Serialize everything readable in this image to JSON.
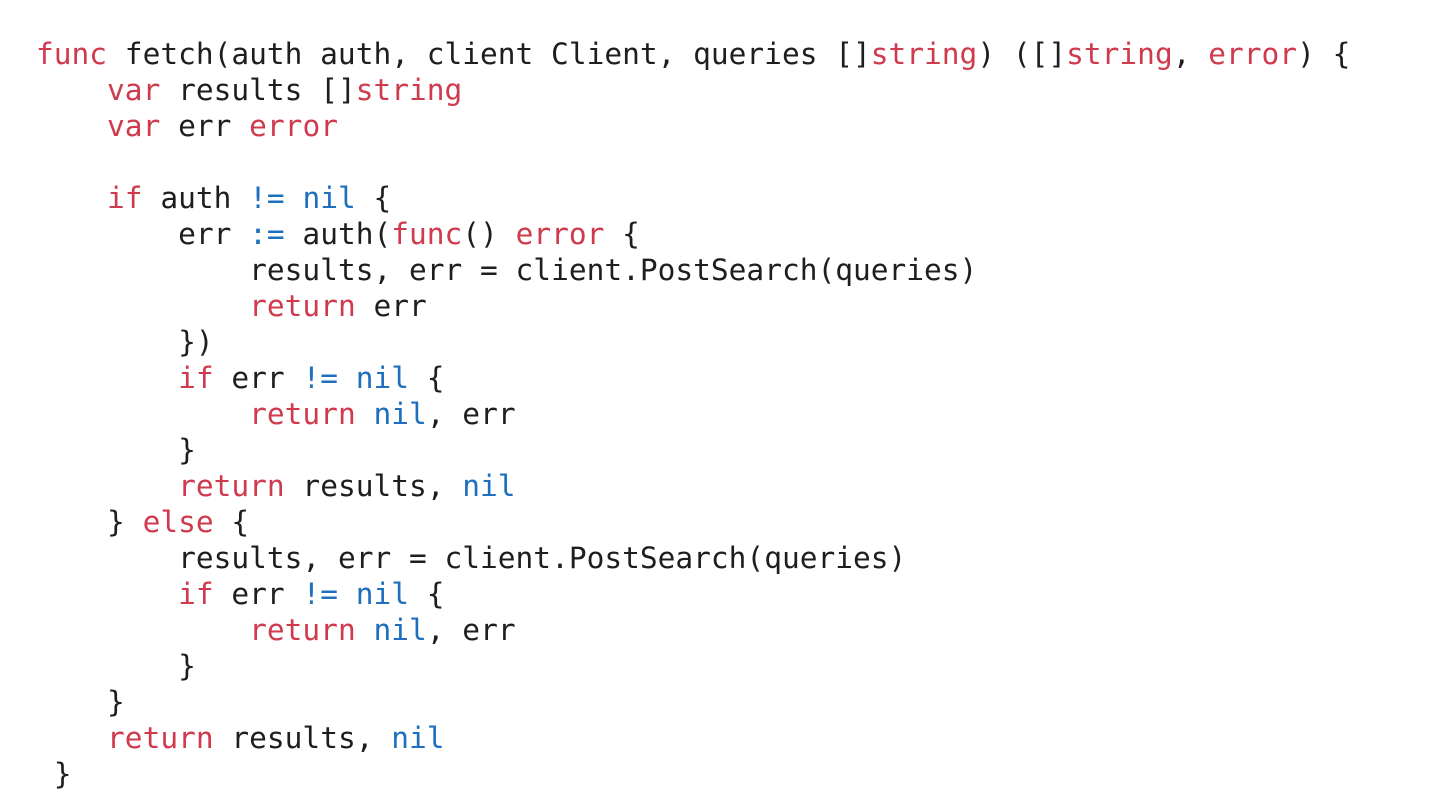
{
  "colors": {
    "keyword": "#cf3a4d",
    "builtin_constant": "#1f6fbf",
    "text": "#1e1e1e",
    "background": "#ffffff"
  },
  "code": {
    "language": "Go",
    "lines": [
      {
        "indent": "",
        "tokens": [
          {
            "t": "func",
            "c": "kw"
          },
          {
            "t": " fetch(auth auth, client Client, queries []",
            "c": "id"
          },
          {
            "t": "string",
            "c": "kw"
          },
          {
            "t": ") ([]",
            "c": "id"
          },
          {
            "t": "string",
            "c": "kw"
          },
          {
            "t": ", ",
            "c": "id"
          },
          {
            "t": "error",
            "c": "kw"
          },
          {
            "t": ") {",
            "c": "id"
          }
        ]
      },
      {
        "indent": "    ",
        "tokens": [
          {
            "t": "var",
            "c": "kw"
          },
          {
            "t": " results []",
            "c": "id"
          },
          {
            "t": "string",
            "c": "kw"
          }
        ]
      },
      {
        "indent": "    ",
        "tokens": [
          {
            "t": "var",
            "c": "kw"
          },
          {
            "t": " err ",
            "c": "id"
          },
          {
            "t": "error",
            "c": "kw"
          }
        ]
      },
      {
        "indent": "",
        "tokens": []
      },
      {
        "indent": "    ",
        "tokens": [
          {
            "t": "if",
            "c": "kw"
          },
          {
            "t": " auth ",
            "c": "id"
          },
          {
            "t": "!=",
            "c": "op"
          },
          {
            "t": " ",
            "c": "id"
          },
          {
            "t": "nil",
            "c": "op"
          },
          {
            "t": " {",
            "c": "id"
          }
        ]
      },
      {
        "indent": "        ",
        "tokens": [
          {
            "t": "err ",
            "c": "id"
          },
          {
            "t": ":=",
            "c": "op"
          },
          {
            "t": " auth(",
            "c": "id"
          },
          {
            "t": "func",
            "c": "kw"
          },
          {
            "t": "() ",
            "c": "id"
          },
          {
            "t": "error",
            "c": "kw"
          },
          {
            "t": " {",
            "c": "id"
          }
        ]
      },
      {
        "indent": "            ",
        "tokens": [
          {
            "t": "results, err = client.PostSearch(queries)",
            "c": "id"
          }
        ]
      },
      {
        "indent": "            ",
        "tokens": [
          {
            "t": "return",
            "c": "kw"
          },
          {
            "t": " err",
            "c": "id"
          }
        ]
      },
      {
        "indent": "        ",
        "tokens": [
          {
            "t": "})",
            "c": "id"
          }
        ]
      },
      {
        "indent": "        ",
        "tokens": [
          {
            "t": "if",
            "c": "kw"
          },
          {
            "t": " err ",
            "c": "id"
          },
          {
            "t": "!=",
            "c": "op"
          },
          {
            "t": " ",
            "c": "id"
          },
          {
            "t": "nil",
            "c": "op"
          },
          {
            "t": " {",
            "c": "id"
          }
        ]
      },
      {
        "indent": "            ",
        "tokens": [
          {
            "t": "return",
            "c": "kw"
          },
          {
            "t": " ",
            "c": "id"
          },
          {
            "t": "nil",
            "c": "op"
          },
          {
            "t": ", err",
            "c": "id"
          }
        ]
      },
      {
        "indent": "        ",
        "tokens": [
          {
            "t": "}",
            "c": "id"
          }
        ]
      },
      {
        "indent": "        ",
        "tokens": [
          {
            "t": "return",
            "c": "kw"
          },
          {
            "t": " results, ",
            "c": "id"
          },
          {
            "t": "nil",
            "c": "op"
          }
        ]
      },
      {
        "indent": "    ",
        "tokens": [
          {
            "t": "} ",
            "c": "id"
          },
          {
            "t": "else",
            "c": "kw"
          },
          {
            "t": " {",
            "c": "id"
          }
        ]
      },
      {
        "indent": "        ",
        "tokens": [
          {
            "t": "results, err = client.PostSearch(queries)",
            "c": "id"
          }
        ]
      },
      {
        "indent": "        ",
        "tokens": [
          {
            "t": "if",
            "c": "kw"
          },
          {
            "t": " err ",
            "c": "id"
          },
          {
            "t": "!=",
            "c": "op"
          },
          {
            "t": " ",
            "c": "id"
          },
          {
            "t": "nil",
            "c": "op"
          },
          {
            "t": " {",
            "c": "id"
          }
        ]
      },
      {
        "indent": "            ",
        "tokens": [
          {
            "t": "return",
            "c": "kw"
          },
          {
            "t": " ",
            "c": "id"
          },
          {
            "t": "nil",
            "c": "op"
          },
          {
            "t": ", err",
            "c": "id"
          }
        ]
      },
      {
        "indent": "        ",
        "tokens": [
          {
            "t": "}",
            "c": "id"
          }
        ]
      },
      {
        "indent": "    ",
        "tokens": [
          {
            "t": "}",
            "c": "id"
          }
        ]
      },
      {
        "indent": "    ",
        "tokens": [
          {
            "t": "return",
            "c": "kw"
          },
          {
            "t": " results, ",
            "c": "id"
          },
          {
            "t": "nil",
            "c": "op"
          }
        ]
      },
      {
        "indent": " ",
        "tokens": [
          {
            "t": "}",
            "c": "id"
          }
        ]
      }
    ]
  }
}
